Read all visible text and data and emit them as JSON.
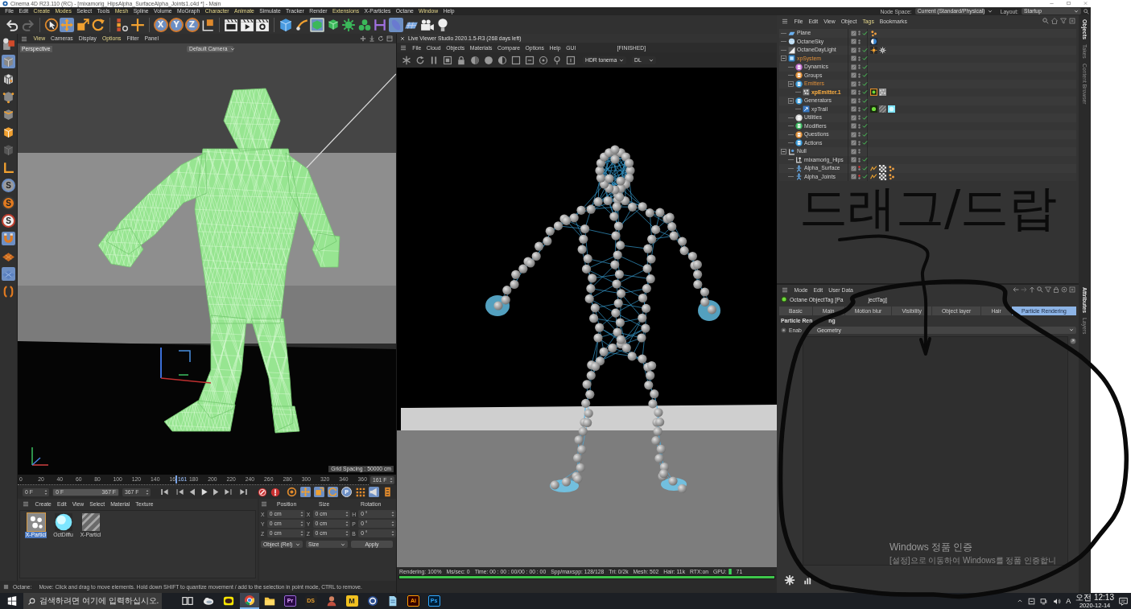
{
  "window": {
    "title": "Cinema 4D R23.110 (RC) - [mixamorig_HipsAlpha_SurfaceAlpha_Joints1.c4d *] - Main"
  },
  "menu_bar": {
    "items": [
      {
        "label": "File",
        "accent": false
      },
      {
        "label": "Edit",
        "accent": false
      },
      {
        "label": "Create",
        "accent": true
      },
      {
        "label": "Modes",
        "accent": true
      },
      {
        "label": "Select",
        "accent": false
      },
      {
        "label": "Tools",
        "accent": false
      },
      {
        "label": "Mesh",
        "accent": true
      },
      {
        "label": "Spline",
        "accent": false
      },
      {
        "label": "Volume",
        "accent": false
      },
      {
        "label": "MoGraph",
        "accent": false
      },
      {
        "label": "Character",
        "accent": true
      },
      {
        "label": "Animate",
        "accent": true
      },
      {
        "label": "Simulate",
        "accent": false
      },
      {
        "label": "Tracker",
        "accent": false
      },
      {
        "label": "Render",
        "accent": false
      },
      {
        "label": "Extensions",
        "accent": true
      },
      {
        "label": "X-Particles",
        "accent": false
      },
      {
        "label": "Octane",
        "accent": false
      },
      {
        "label": "Window",
        "accent": true
      },
      {
        "label": "Help",
        "accent": false
      }
    ],
    "node_space": {
      "label": "Node Space:",
      "value": "Current (Standard/Physical)"
    },
    "layout": {
      "label": "Layout:",
      "value": "Startup"
    }
  },
  "toolbar": [
    [
      {
        "selected": false
      },
      {
        "selected": false
      }
    ],
    [
      {
        "selected": false
      },
      {
        "selected": true
      },
      {
        "selected": false
      },
      {
        "selected": false
      }
    ],
    [
      {
        "selected": false
      },
      {
        "selected": false
      }
    ],
    [
      {
        "label": "X",
        "selected": true
      },
      {
        "label": "Y",
        "selected": true
      },
      {
        "label": "Z",
        "selected": true
      },
      {
        "selected": false
      }
    ],
    [
      {
        "selected": false
      },
      {
        "selected": false
      },
      {
        "selected": false
      }
    ],
    [
      {
        "selected": false
      },
      {
        "selected": false
      },
      {
        "selected": true
      },
      {
        "selected": false
      },
      {
        "selected": false
      },
      {
        "selected": false
      },
      {
        "selected": false
      },
      {
        "selected": true
      },
      {
        "selected": false
      },
      {
        "selected": false
      },
      {
        "selected": false
      }
    ]
  ],
  "left_palette": [
    {
      "selected": false
    },
    {
      "selected": true
    },
    {
      "selected": false
    },
    {
      "selected": false
    },
    {
      "selected": false
    },
    {
      "selected": false
    },
    {
      "selected": false
    },
    {
      "selected": false
    },
    {
      "label": "S",
      "selected": true
    },
    {
      "label": "S",
      "selected": false
    },
    {
      "label": "S",
      "selected": false
    },
    {
      "selected": true
    },
    {
      "selected": false
    },
    {
      "selected": true
    },
    {
      "selected": false
    }
  ],
  "viewport": {
    "menu": [
      {
        "label": "View",
        "accent": true
      },
      {
        "label": "Cameras",
        "accent": false
      },
      {
        "label": "Display",
        "accent": false
      },
      {
        "label": "Options",
        "accent": true
      },
      {
        "label": "Filter",
        "accent": false
      },
      {
        "label": "Panel",
        "accent": false
      }
    ],
    "camera": "Perspective",
    "camera_menu": "Default Camera",
    "grid_spacing": "Grid Spacing : 50000 cm"
  },
  "timeline": {
    "ticks": [
      "0",
      "20",
      "40",
      "60",
      "80",
      "100",
      "120",
      "140",
      "16",
      "180",
      "200",
      "220",
      "240",
      "260",
      "280",
      "300",
      "320",
      "340",
      "360"
    ],
    "playhead": {
      "level": 0.447,
      "label": "161"
    },
    "current_field": "161 F",
    "start_field": "0 F",
    "range": {
      "start": "0 F",
      "end": "367 F",
      "level": 1
    },
    "end_field": "367 F",
    "playback": [
      {
        "selected": false
      },
      {
        "selected": false
      },
      {
        "selected": false
      },
      {
        "selected": false
      },
      {
        "selected": false
      },
      {
        "selected": false
      },
      {
        "selected": false
      }
    ],
    "keying": [
      {
        "selected": false
      },
      {
        "selected": false
      }
    ],
    "key_filters": [
      {
        "selected": false
      },
      {
        "selected": true
      },
      {
        "selected": true
      },
      {
        "selected": true
      },
      {
        "label": "P",
        "selected": true
      },
      {
        "selected": false
      }
    ],
    "views": [
      {
        "selected": true
      },
      {
        "selected": false
      }
    ]
  },
  "material_manager": {
    "menu": [
      "Create",
      "Edit",
      "View",
      "Select",
      "Material",
      "Texture"
    ],
    "materials": [
      {
        "name": "X-Particl",
        "selected": true
      },
      {
        "name": "OctDiffu",
        "selected": false
      },
      {
        "name": "X-Particl",
        "selected": false
      }
    ]
  },
  "coordinates": {
    "headers": [
      "Position",
      "Size",
      "Rotation"
    ],
    "rows": [
      [
        {
          "axis": "X",
          "value": "0 cm"
        },
        {
          "axis": "X",
          "value": "0 cm"
        },
        {
          "axis": "H",
          "value": "0 °"
        }
      ],
      [
        {
          "axis": "Y",
          "value": "0 cm"
        },
        {
          "axis": "Y",
          "value": "0 cm"
        },
        {
          "axis": "P",
          "value": "0 °"
        }
      ],
      [
        {
          "axis": "Z",
          "value": "0 cm"
        },
        {
          "axis": "Z",
          "value": "0 cm"
        },
        {
          "axis": "B",
          "value": "0 °"
        }
      ]
    ],
    "mode": "Object (Rel)",
    "size_mode": "Size",
    "apply": "Apply"
  },
  "status_line": {
    "source": "Octane:",
    "message": "Move: Click and drag to move elements. Hold down SHIFT to quantize movement / add to the selection in point mode, CTRL to remove."
  },
  "live_viewer": {
    "title": "Live Viewer Studio 2020.1.5-R3 (268 days left)",
    "menu": [
      "File",
      "Cloud",
      "Objects",
      "Materials",
      "Compare",
      "Options",
      "Help",
      "GUI"
    ],
    "state": "[FINISHED]",
    "tonemap": "HDR tonema",
    "kernel": "DL",
    "stats": [
      "Rendering: 100%",
      "Ms/sec: 0",
      "Time: 00 : 00 : 00/00 : 00 : 00",
      "Spp/maxspp: 128/128",
      "Tri: 0/2k",
      "Mesh: 502",
      "Hair: 11k",
      "RTX:on"
    ],
    "gpu": {
      "label": "GPU:",
      "value": "71"
    },
    "progress": {
      "level": 1
    }
  },
  "object_manager": {
    "menu": [
      {
        "label": "File",
        "accent": false
      },
      {
        "label": "Edit",
        "accent": false
      },
      {
        "label": "View",
        "accent": false
      },
      {
        "label": "Object",
        "accent": false
      },
      {
        "label": "Tags",
        "accent": true
      },
      {
        "label": "Bookmarks",
        "accent": false
      }
    ],
    "objects": [
      {
        "name": "Plane",
        "kind": "plane",
        "enabled": true,
        "editor_hidden": false,
        "selected": false,
        "highlighted": false,
        "tags": [
          {
            "kind": "dots",
            "selected": false
          }
        ]
      },
      {
        "name": "OctaneSky",
        "kind": "sky",
        "enabled": false,
        "editor_hidden": false,
        "selected": false,
        "highlighted": false,
        "tags": [
          {
            "kind": "sky",
            "selected": false
          }
        ]
      },
      {
        "name": "OctaneDayLight",
        "kind": "light",
        "enabled": true,
        "editor_hidden": false,
        "selected": false,
        "highlighted": false,
        "tags": [
          {
            "kind": "sun",
            "selected": false
          },
          {
            "kind": "gear",
            "selected": false
          }
        ]
      },
      {
        "name": "xpSystem",
        "kind": "system",
        "enabled": true,
        "editor_hidden": false,
        "selected": false,
        "highlighted": true,
        "children": [
          {
            "name": "Dynamics",
            "kind": "folder",
            "color": "#c070d0",
            "enabled": true,
            "editor_hidden": false,
            "selected": false,
            "highlighted": false
          },
          {
            "name": "Groups",
            "kind": "folder",
            "color": "#e0903a",
            "enabled": true,
            "editor_hidden": false,
            "selected": false,
            "highlighted": false
          },
          {
            "name": "Emitters",
            "kind": "folder",
            "color": "#3a9ad8",
            "enabled": true,
            "editor_hidden": false,
            "selected": false,
            "highlighted": true,
            "children": [
              {
                "name": "xpEmitter.1",
                "kind": "emitter",
                "enabled": true,
                "editor_hidden": false,
                "selected": true,
                "highlighted": true,
                "tags": [
                  {
                    "kind": "octane",
                    "selected": true
                  },
                  {
                    "kind": "texture",
                    "selected": false
                  }
                ]
              }
            ]
          },
          {
            "name": "Generators",
            "kind": "folder",
            "color": "#3a9ad8",
            "enabled": true,
            "editor_hidden": false,
            "selected": false,
            "highlighted": false,
            "children": [
              {
                "name": "xpTrail",
                "kind": "trail",
                "enabled": true,
                "editor_hidden": false,
                "selected": false,
                "highlighted": false,
                "tags": [
                  {
                    "kind": "octane",
                    "selected": false
                  },
                  {
                    "kind": "hatched",
                    "selected": false
                  },
                  {
                    "kind": "cyan",
                    "selected": false
                  }
                ]
              }
            ]
          },
          {
            "name": "Utilities",
            "kind": "folder",
            "color": "#d8d8d8",
            "enabled": true,
            "editor_hidden": false,
            "selected": false,
            "highlighted": false
          },
          {
            "name": "Modifiers",
            "kind": "folder",
            "color": "#3cb860",
            "enabled": true,
            "editor_hidden": false,
            "selected": false,
            "highlighted": false
          },
          {
            "name": "Questions",
            "kind": "folder",
            "color": "#e0903a",
            "enabled": true,
            "editor_hidden": false,
            "selected": false,
            "highlighted": false
          },
          {
            "name": "Actions",
            "kind": "folder",
            "color": "#3a9ad8",
            "enabled": true,
            "editor_hidden": false,
            "selected": false,
            "highlighted": false
          }
        ]
      },
      {
        "name": "Null",
        "kind": "null",
        "enabled": false,
        "editor_hidden": false,
        "selected": false,
        "highlighted": false,
        "children": [
          {
            "name": "mixamorig_Hips",
            "kind": "joint",
            "enabled": true,
            "editor_hidden": false,
            "selected": false,
            "highlighted": false
          },
          {
            "name": "Alpha_Surface",
            "kind": "figure",
            "enabled": true,
            "editor_hidden": true,
            "selected": false,
            "highlighted": false,
            "tags": [
              {
                "kind": "ik",
                "selected": false
              },
              {
                "kind": "checker",
                "selected": false
              },
              {
                "kind": "dots",
                "selected": false
              }
            ]
          },
          {
            "name": "Alpha_Joints",
            "kind": "figure",
            "enabled": true,
            "editor_hidden": true,
            "selected": false,
            "highlighted": false,
            "tags": [
              {
                "kind": "ik",
                "selected": false
              },
              {
                "kind": "checker",
                "selected": false
              },
              {
                "kind": "dots",
                "selected": false
              }
            ]
          }
        ]
      }
    ],
    "side_tabs": [
      {
        "label": "Objects",
        "selected": true
      },
      {
        "label": "Takes",
        "selected": false
      },
      {
        "label": "Content Browser",
        "selected": false
      }
    ]
  },
  "attribute_manager": {
    "menu": [
      "Mode",
      "Edit",
      "User Data"
    ],
    "header": [
      "Octane ObjectTag [Pa",
      "jectTag]"
    ],
    "tabs": [
      {
        "label": "Basic",
        "selected": false
      },
      {
        "label": "Main",
        "selected": false
      },
      {
        "label": "Motion blur",
        "selected": false
      },
      {
        "label": "Visibility",
        "selected": false
      },
      {
        "label": "Object layer",
        "selected": false
      },
      {
        "label": "Hair",
        "selected": false
      },
      {
        "label": "Particle Rendering",
        "selected": true
      }
    ],
    "section": [
      "Particle Ren",
      "ng"
    ],
    "enable": {
      "label": "Enab",
      "value": "Geometry"
    },
    "side_tabs": [
      {
        "label": "Attributes",
        "selected": true
      },
      {
        "label": "Layers",
        "selected": false
      }
    ]
  },
  "activation_notice": {
    "title": "Windows 정품 인증",
    "message": "[설정]으로 이동하여 Windows를 정품 인증합니"
  },
  "annotation": {
    "text": "드래그/드랍"
  },
  "taskbar": {
    "search_placeholder": "검색하려면 여기에 입력하십시오.",
    "apps": [
      {
        "active": false
      },
      {
        "active": false
      },
      {
        "active": false
      },
      {
        "active": true
      },
      {
        "active": false
      },
      {
        "label": "Pr",
        "active": false
      },
      {
        "label": "DS",
        "active": false
      },
      {
        "active": false
      },
      {
        "label": "M",
        "active": false
      },
      {
        "active": false
      },
      {
        "active": false
      },
      {
        "label": "Ai",
        "active": false
      },
      {
        "label": "Ps",
        "active": false
      }
    ],
    "ime": "A",
    "time": "오전 12:13",
    "date": "2020-12-14"
  }
}
